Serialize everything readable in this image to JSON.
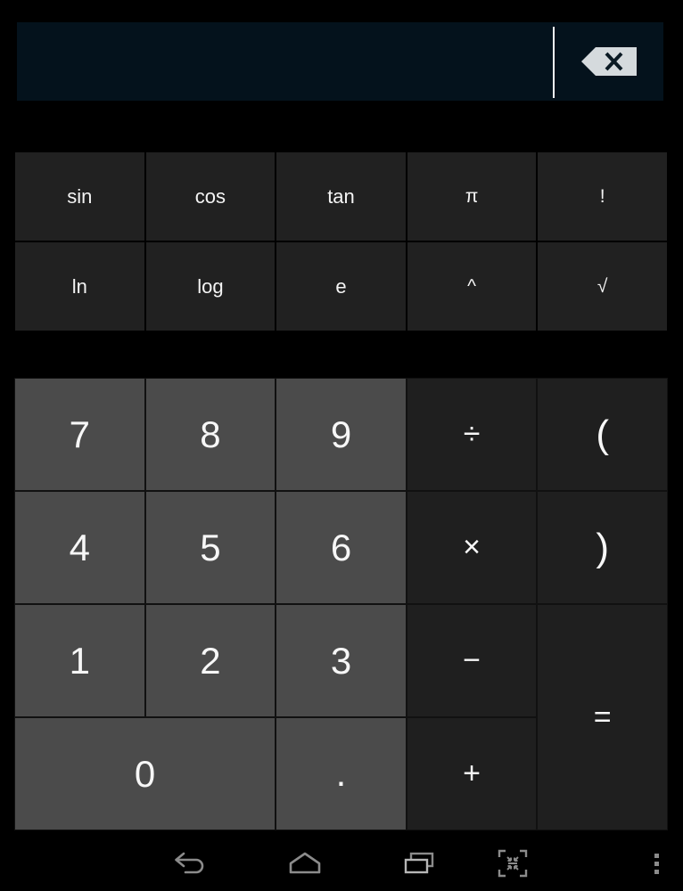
{
  "app": {
    "name": "Calculator",
    "theme": {
      "background": "#000000",
      "display_bg": "#04121c",
      "function_key_bg": "#212121",
      "number_key_bg": "#4b4b4b",
      "operator_key_bg": "#1f1f1f",
      "key_text": "#f7f7f7",
      "caret": "#f2f7fa",
      "backspace_fill": "#d5dadd",
      "nav_icon": "#8b8b8b"
    }
  },
  "display": {
    "value": "",
    "placeholder": "",
    "caret_visible": true,
    "backspace_icon": "backspace-icon"
  },
  "function_pad": {
    "rows": [
      [
        {
          "label": "sin",
          "name": "sin-key"
        },
        {
          "label": "cos",
          "name": "cos-key"
        },
        {
          "label": "tan",
          "name": "tan-key"
        },
        {
          "label": "π",
          "name": "pi-key"
        },
        {
          "label": "!",
          "name": "factorial-key"
        }
      ],
      [
        {
          "label": "ln",
          "name": "ln-key"
        },
        {
          "label": "log",
          "name": "log-key"
        },
        {
          "label": "e",
          "name": "e-key"
        },
        {
          "label": "^",
          "name": "power-key"
        },
        {
          "label": "√",
          "name": "sqrt-key"
        }
      ]
    ]
  },
  "keypad": {
    "keys": {
      "seven": "7",
      "eight": "8",
      "nine": "9",
      "divide": "÷",
      "open_paren": "(",
      "four": "4",
      "five": "5",
      "six": "6",
      "multiply": "×",
      "close_paren": ")",
      "one": "1",
      "two": "2",
      "three": "3",
      "minus": "−",
      "equals": "=",
      "zero": "0",
      "decimal": ".",
      "plus": "+"
    }
  },
  "navbar": {
    "items": [
      {
        "name": "back-icon",
        "label": "Back"
      },
      {
        "name": "home-icon",
        "label": "Home"
      },
      {
        "name": "recents-icon",
        "label": "Recent apps"
      },
      {
        "name": "fit-to-screen-icon",
        "label": "Fit to screen"
      },
      {
        "name": "overflow-menu-icon",
        "label": "More options"
      }
    ]
  }
}
